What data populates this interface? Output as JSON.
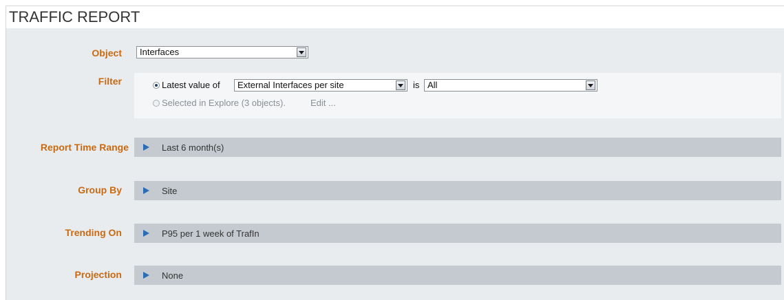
{
  "header": {
    "title": "TRAFFIC REPORT"
  },
  "object": {
    "label": "Object",
    "value": "Interfaces"
  },
  "filter": {
    "label": "Filter",
    "option1_text": "Latest value of",
    "attribute_value": "External Interfaces per site",
    "is_text": "is",
    "condition_value": "All",
    "option2_text": "Selected in Explore (3 objects).",
    "edit_link": "Edit ..."
  },
  "sections": [
    {
      "label": "Report Time Range",
      "value": "Last 6 month(s)"
    },
    {
      "label": "Group By",
      "value": "Site"
    },
    {
      "label": "Trending On",
      "value": "P95 per 1 week of TrafIn"
    },
    {
      "label": "Projection",
      "value": "None"
    }
  ],
  "colors": {
    "label": "#c96a12",
    "accent": "#2a6cb5",
    "bar": "#c4cacf",
    "panel": "#e9ecee"
  }
}
